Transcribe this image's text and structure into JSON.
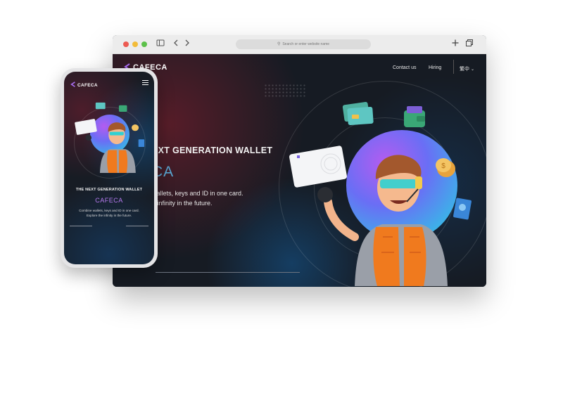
{
  "browser": {
    "address_placeholder": "Search or enter website name",
    "icons": [
      "sidebar-icon",
      "back-icon",
      "forward-icon",
      "new-tab-icon",
      "tabs-icon"
    ]
  },
  "site": {
    "logo_text": "CAFECA",
    "nav": {
      "contact": "Contact us",
      "hiring": "Hiring",
      "language": "繁中"
    },
    "hero": {
      "heading": "EXT GENERATION WALLET",
      "brand": "CA",
      "description_line1": "wallets, keys and ID in one card.",
      "description_line2": "e infinity in the future."
    }
  },
  "mobile": {
    "logo_text": "CAFECA",
    "heading": "THE NEXT GENERATION WALLET",
    "brand": "CAFECA",
    "description_line1": "Combine wallets, keys and ID in one card.",
    "description_line2": "Explore the infinity in the future."
  },
  "colors": {
    "page_bg": "#161b23",
    "brand_blue": "#5aa8d4",
    "brand_purple": "#b77bf0",
    "accent_orange": "#f07a1e"
  }
}
